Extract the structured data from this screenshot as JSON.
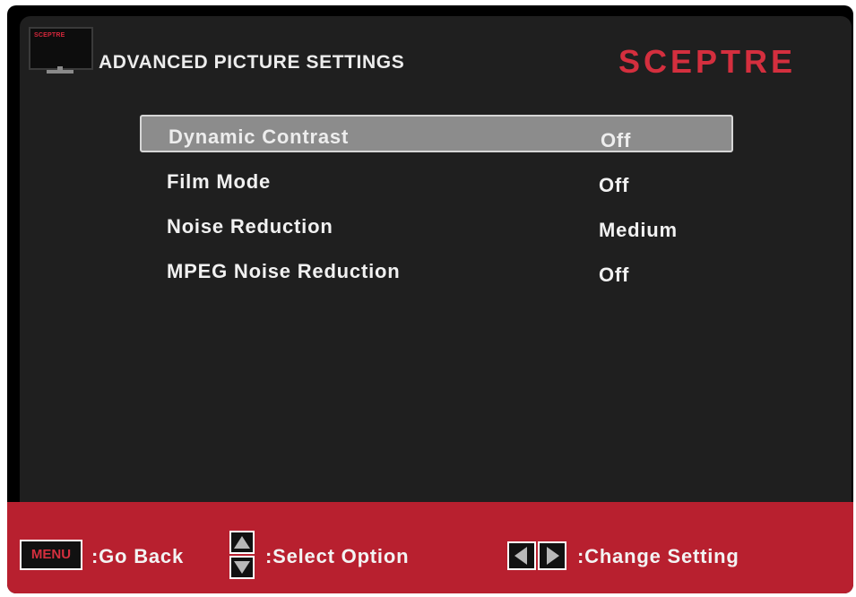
{
  "header": {
    "title": "ADVANCED PICTURE SETTINGS",
    "brand": "SCEPTRE",
    "icon_text": "SCEPTRE"
  },
  "menu": {
    "items": [
      {
        "label": "Dynamic Contrast",
        "value": "Off",
        "selected": true
      },
      {
        "label": "Film Mode",
        "value": "Off",
        "selected": false
      },
      {
        "label": "Noise Reduction",
        "value": "Medium",
        "selected": false
      },
      {
        "label": "MPEG Noise Reduction",
        "value": "Off",
        "selected": false
      }
    ]
  },
  "footer": {
    "menu_key": "MENU",
    "go_back": ":Go Back",
    "select_option": ":Select Option",
    "change_setting": ":Change Setting"
  },
  "colors": {
    "accent": "#d42f3e",
    "footer_bg": "#b8202f",
    "panel_bg": "#1f1f1f",
    "highlight": "#8c8c8c"
  },
  "icons": [
    "tv-icon",
    "up-arrow-icon",
    "down-arrow-icon",
    "left-arrow-icon",
    "right-arrow-icon"
  ]
}
